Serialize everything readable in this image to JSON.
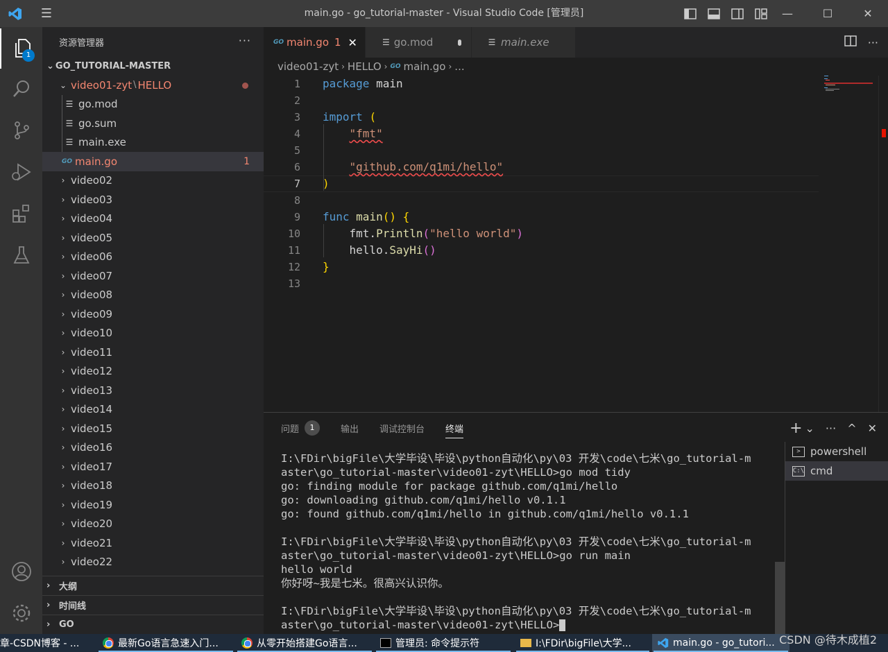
{
  "window": {
    "title": "main.go - go_tutorial-master - Visual Studio Code [管理员]",
    "minimize": "—",
    "maximize": "☐",
    "close": "✕"
  },
  "activity": {
    "explorer_badge": "1"
  },
  "sidebar": {
    "header": "资源管理器",
    "more": "···",
    "root": "GO_TUTORIAL-MASTER",
    "open_folder": "video01-zyt",
    "open_folder_sep": "\\",
    "open_folder_sub": "HELLO",
    "files": [
      {
        "name": "go.mod"
      },
      {
        "name": "go.sum"
      },
      {
        "name": "main.exe"
      },
      {
        "name": "main.go",
        "problems": "1"
      }
    ],
    "folders": [
      "video02",
      "video03",
      "video04",
      "video05",
      "video06",
      "video07",
      "video08",
      "video09",
      "video10",
      "video11",
      "video12",
      "video13",
      "video14",
      "video15",
      "video16",
      "video17",
      "video18",
      "video19",
      "video20",
      "video21",
      "video22"
    ],
    "outline": "大纲",
    "timeline": "时间线",
    "go": "GO"
  },
  "tabs": [
    {
      "label": "main.go",
      "problems": "1",
      "close": "✕"
    },
    {
      "label": "go.mod"
    },
    {
      "label": "main.exe"
    }
  ],
  "breadcrumb": {
    "folder": "video01-zyt",
    "sub": "HELLO",
    "file": "main.go",
    "ellipsis": "..."
  },
  "editor": {
    "line_numbers": [
      "1",
      "2",
      "3",
      "4",
      "5",
      "6",
      "7",
      "8",
      "9",
      "10",
      "11",
      "12",
      "13"
    ],
    "current_line": 7,
    "tokens": {
      "package_kw": "package",
      "package_name": "main",
      "import_kw": "import",
      "open_paren": "(",
      "imp1": "\"fmt\"",
      "imp2": "\"github.com/q1mi/hello\"",
      "close_paren": ")",
      "func_kw": "func",
      "main_fn": "main",
      "func_parens": "()",
      "open_brace": "{",
      "fmt_pkg": "fmt.",
      "println_fn": "Println",
      "println_open": "(",
      "hello_str": "\"hello world\"",
      "println_close": ")",
      "hello_pkg": "hello.",
      "sayhi_fn": "SayHi",
      "sayhi_parens": "()",
      "close_brace": "}"
    }
  },
  "panel": {
    "tabs": {
      "problems": "问题",
      "problems_count": "1",
      "output": "输出",
      "debug": "调试控制台",
      "terminal": "终端"
    },
    "actions": {
      "add": "+",
      "dropdown": "⌄",
      "more": "···",
      "maximize": "^",
      "close": "✕"
    },
    "terminal_lines": [
      "I:\\FDir\\bigFile\\大学毕设\\毕设\\python自动化\\py\\03 开发\\code\\七米\\go_tutorial-m",
      "aster\\go_tutorial-master\\video01-zyt\\HELLO>go mod tidy",
      "go: finding module for package github.com/q1mi/hello",
      "go: downloading github.com/q1mi/hello v0.1.1",
      "go: found github.com/q1mi/hello in github.com/q1mi/hello v0.1.1",
      "",
      "I:\\FDir\\bigFile\\大学毕设\\毕设\\python自动化\\py\\03 开发\\code\\七米\\go_tutorial-m",
      "aster\\go_tutorial-master\\video01-zyt\\HELLO>go run main",
      "hello world",
      "你好呀~我是七米。很高兴认识你。",
      "",
      "I:\\FDir\\bigFile\\大学毕设\\毕设\\python自动化\\py\\03 开发\\code\\七米\\go_tutorial-m",
      "aster\\go_tutorial-master\\video01-zyt\\HELLO>"
    ],
    "terminals": [
      {
        "name": "powershell",
        "icon": ">"
      },
      {
        "name": "cmd",
        "icon": "C:\\"
      }
    ]
  },
  "taskbar": {
    "items": [
      "章-CSDN博客 - ...",
      "最新Go语言急速入门...",
      "从零开始搭建Go语言...",
      "管理员: 命令提示符",
      "I:\\FDir\\bigFile\\大学...",
      "main.go - go_tutori..."
    ]
  },
  "watermark": "CSDN @待木成植2",
  "colors": {
    "accent": "#007acc",
    "error": "#f48771",
    "background": "#1e1e1e"
  }
}
